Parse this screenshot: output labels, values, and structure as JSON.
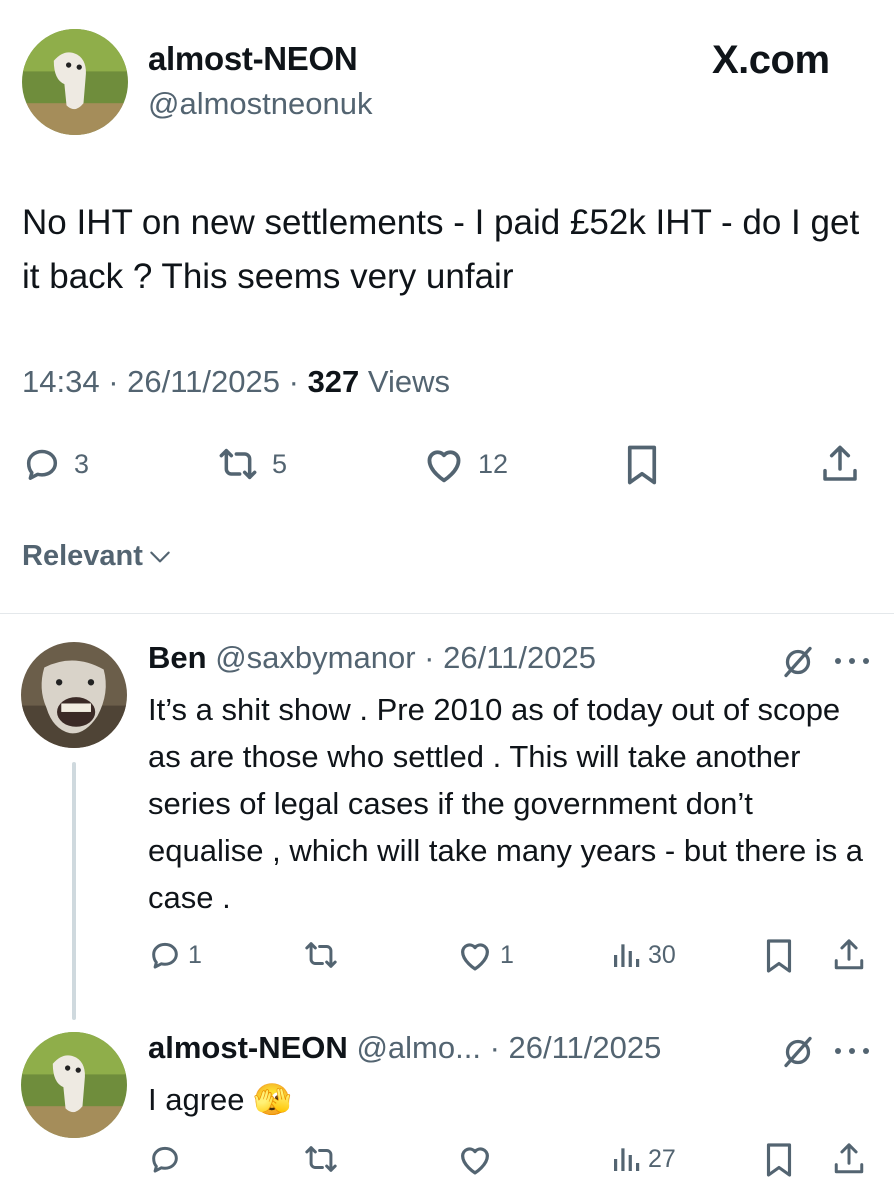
{
  "brand": {
    "site": "X.com"
  },
  "tweet": {
    "author_name": "almost-NEON",
    "author_handle": "@almostneonuk",
    "text": "No IHT on new settlements - I paid £52k IHT - do I get it back ? This seems very unfair",
    "time": "14:34",
    "date": "26/11/2025",
    "views_count": "327",
    "views_label": "Views",
    "replies": "3",
    "reposts": "5",
    "likes": "12"
  },
  "filter": {
    "label": "Relevant"
  },
  "replies": [
    {
      "author_name": "Ben",
      "author_handle": "@saxbymanor",
      "date": "26/11/2025",
      "text": "It’s a shit show . Pre 2010 as of today out of scope as are those who settled . This will take another series of legal cases if the government don’t equalise , which will take many years - but there is a case .",
      "replies": "1",
      "reposts": "",
      "likes": "1",
      "views": "30"
    },
    {
      "author_name": "almost-NEON",
      "author_handle": "@almo...",
      "date": "26/11/2025",
      "text": "I agree 🫣",
      "replies": "",
      "reposts": "",
      "likes": "",
      "views": "27"
    }
  ],
  "icons": {
    "reply": "reply-icon",
    "repost": "repost-icon",
    "like": "heart-icon",
    "bookmark": "bookmark-icon",
    "share": "share-icon",
    "views": "views-icon",
    "grok": "grok-icon",
    "more": "more-icon",
    "chevron": "chevron-down-icon"
  },
  "colors": {
    "text": "#0f1419",
    "secondary": "#536471",
    "divider": "#e4e8eb",
    "thread": "#cfd9de"
  }
}
